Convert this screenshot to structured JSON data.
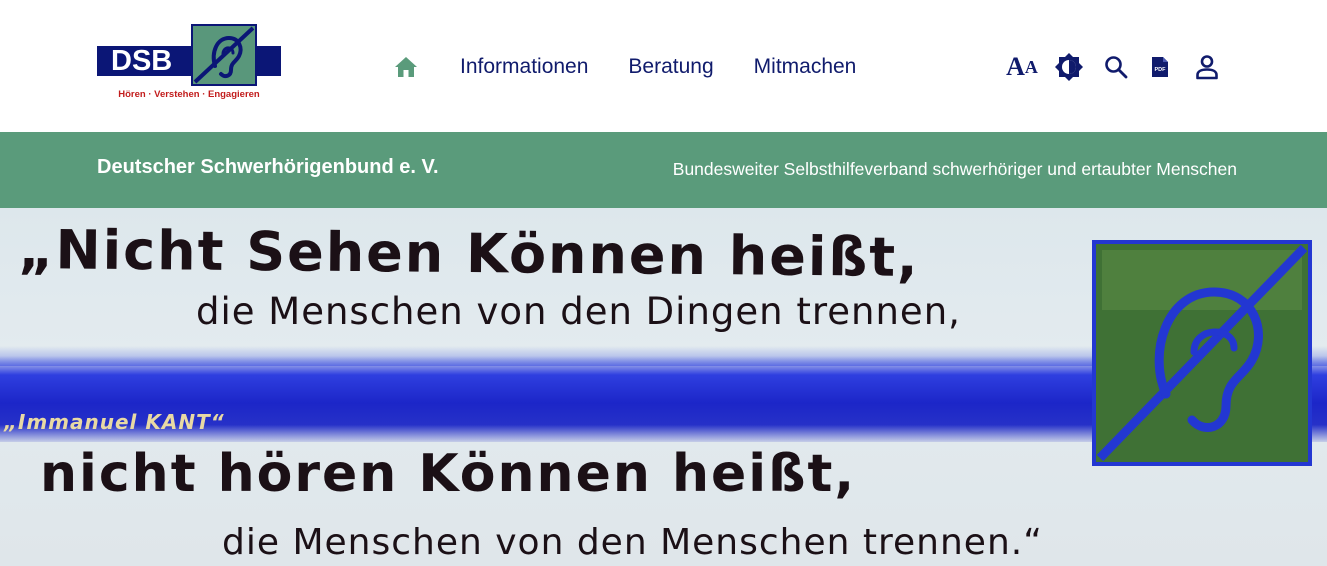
{
  "logo": {
    "abbr": "DSB",
    "tagline": "Hören · Verstehen · Engagieren",
    "colors": {
      "navy": "#0b1676",
      "green": "#59977b",
      "red": "#c21c1c"
    }
  },
  "nav": {
    "home_icon": "home-icon",
    "items": [
      {
        "label": "Informationen"
      },
      {
        "label": "Beratung"
      },
      {
        "label": "Mitmachen"
      }
    ]
  },
  "tools": {
    "font_size": {
      "big": "A",
      "small": "A",
      "icon": "font-size-icon"
    },
    "contrast": {
      "icon": "contrast-icon"
    },
    "search": {
      "icon": "search-icon"
    },
    "pdf": {
      "icon": "pdf-icon",
      "badge": "PDF"
    },
    "user": {
      "icon": "user-icon"
    }
  },
  "band": {
    "title": "Deutscher Schwerhörigenbund e. V.",
    "subtitle": "Bundesweiter Selbsthilfeverband schwerhöriger und ertaubter Menschen",
    "color": "#5a9b7b"
  },
  "hero": {
    "line1": "„Nicht Sehen Können heißt,",
    "line2": "die Menschen von den Dingen trennen,",
    "author": "„Immanuel KANT“",
    "line3": "nicht hören Können heißt,",
    "line4": "die Menschen von den Menschen trennen.“"
  }
}
